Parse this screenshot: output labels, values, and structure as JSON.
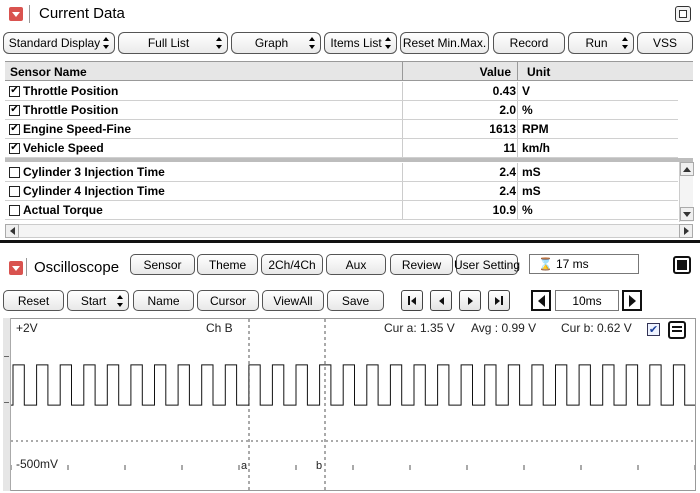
{
  "current_data": {
    "title": "Current Data",
    "toolbar": [
      {
        "label": "Standard Display",
        "spinner": true
      },
      {
        "label": "Full List",
        "spinner": true
      },
      {
        "label": "Graph",
        "spinner": true
      },
      {
        "label": "Items List",
        "spinner": true
      },
      {
        "label": "Reset Min.Max.",
        "spinner": false
      },
      {
        "label": "Record",
        "spinner": false
      },
      {
        "label": "Run",
        "spinner": true
      },
      {
        "label": "VSS",
        "spinner": false
      }
    ],
    "columns": {
      "name": "Sensor Name",
      "value": "Value",
      "unit": "Unit"
    },
    "selected_rows": [
      {
        "name": "Throttle Position",
        "value": "0.43",
        "unit": "V",
        "checked": true
      },
      {
        "name": "Throttle Position",
        "value": "2.0",
        "unit": "%",
        "checked": true
      },
      {
        "name": "Engine Speed-Fine",
        "value": "1613",
        "unit": "RPM",
        "checked": true
      },
      {
        "name": "Vehicle Speed",
        "value": "11",
        "unit": "km/h",
        "checked": true
      }
    ],
    "other_rows": [
      {
        "name": "Cylinder 3 Injection Time",
        "value": "2.4",
        "unit": "mS",
        "checked": false
      },
      {
        "name": "Cylinder 4 Injection Time",
        "value": "2.4",
        "unit": "mS",
        "checked": false
      },
      {
        "name": "Actual Torque",
        "value": "10.9",
        "unit": "%",
        "checked": false
      }
    ]
  },
  "oscilloscope": {
    "title": "Oscilloscope",
    "top_buttons": [
      "Sensor",
      "Theme",
      "2Ch/4Ch",
      "Aux",
      "Review",
      "User Setting"
    ],
    "timer_value": "17 ms",
    "controls": [
      {
        "label": "Reset",
        "spinner": false
      },
      {
        "label": "Start",
        "spinner": true
      },
      {
        "label": "Name",
        "spinner": false
      },
      {
        "label": "Cursor",
        "spinner": false
      },
      {
        "label": "ViewAll",
        "spinner": false
      },
      {
        "label": "Save",
        "spinner": false
      }
    ],
    "timebase": "10ms",
    "plot": {
      "top_label": "+2V",
      "bottom_label": "-500mV",
      "channel": "Ch B",
      "cur_a": "Cur a: 1.35 V",
      "avg": "Avg  : 0.99 V",
      "cur_b": "Cur b: 0.62 V",
      "cursor_a": "a",
      "cursor_b": "b",
      "high_level_v": 1.35,
      "low_level_v": 0.62,
      "cycle_count": 29
    }
  },
  "colors": {
    "accent_red": "#d9534f",
    "trace": "#111111"
  }
}
